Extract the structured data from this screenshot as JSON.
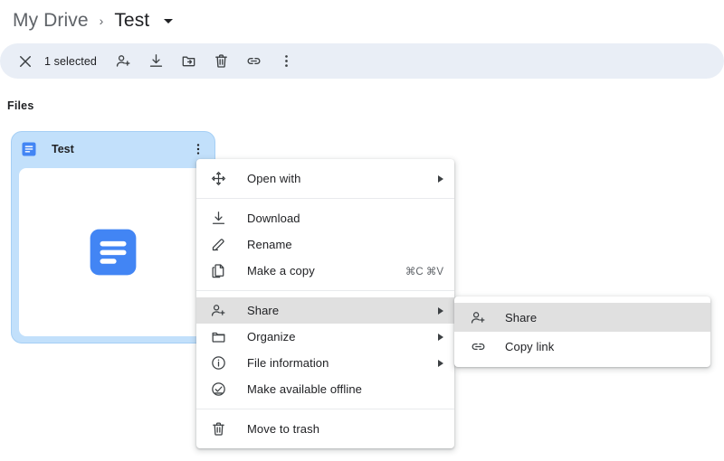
{
  "breadcrumb": {
    "root": "My Drive",
    "separator": "›",
    "current": "Test"
  },
  "toolbar": {
    "close_label": "close-icon",
    "selection_text": "1 selected",
    "actions": [
      {
        "name": "share-person-add-icon",
        "label": "Share"
      },
      {
        "name": "download-icon",
        "label": "Download"
      },
      {
        "name": "move-to-folder-icon",
        "label": "Move to folder"
      },
      {
        "name": "trash-icon",
        "label": "Move to trash"
      },
      {
        "name": "link-icon",
        "label": "Get link"
      },
      {
        "name": "more-vert-icon",
        "label": "More actions"
      }
    ]
  },
  "section": {
    "title": "Files"
  },
  "file_card": {
    "name": "Test",
    "file_type": "google-docs",
    "selected": true
  },
  "context_menu": {
    "items": [
      {
        "id": "open-with",
        "label": "Open with",
        "icon": "open-with-icon",
        "arrow": true,
        "shortcut": "",
        "highlight": false,
        "separator_after": true
      },
      {
        "id": "download",
        "label": "Download",
        "icon": "download-icon",
        "arrow": false,
        "shortcut": "",
        "highlight": false,
        "separator_after": false
      },
      {
        "id": "rename",
        "label": "Rename",
        "icon": "rename-pencil-icon",
        "arrow": false,
        "shortcut": "",
        "highlight": false,
        "separator_after": false
      },
      {
        "id": "make-a-copy",
        "label": "Make a copy",
        "icon": "copy-icon",
        "arrow": false,
        "shortcut": "⌘C ⌘V",
        "highlight": false,
        "separator_after": true
      },
      {
        "id": "share",
        "label": "Share",
        "icon": "share-person-add-icon",
        "arrow": true,
        "shortcut": "",
        "highlight": true,
        "separator_after": false
      },
      {
        "id": "organize",
        "label": "Organize",
        "icon": "folder-icon",
        "arrow": true,
        "shortcut": "",
        "highlight": false,
        "separator_after": false
      },
      {
        "id": "file-information",
        "label": "File information",
        "icon": "info-icon",
        "arrow": true,
        "shortcut": "",
        "highlight": false,
        "separator_after": false
      },
      {
        "id": "make-available-offline",
        "label": "Make available offline",
        "icon": "offline-check-icon",
        "arrow": false,
        "shortcut": "",
        "highlight": false,
        "separator_after": true
      },
      {
        "id": "move-to-trash",
        "label": "Move to trash",
        "icon": "trash-icon",
        "arrow": false,
        "shortcut": "",
        "highlight": false,
        "separator_after": false
      }
    ]
  },
  "share_submenu": {
    "items": [
      {
        "id": "share",
        "label": "Share",
        "icon": "share-person-add-icon",
        "highlight": true
      },
      {
        "id": "copy-link",
        "label": "Copy link",
        "icon": "link-icon",
        "highlight": false
      }
    ]
  },
  "colors": {
    "selection_bar": "#e9eef6",
    "card_selected": "#c2e0fb",
    "docs_blue": "#4285f4",
    "menu_highlight": "#e0e0e0",
    "text_primary": "#202124",
    "text_secondary": "#5f6368"
  }
}
